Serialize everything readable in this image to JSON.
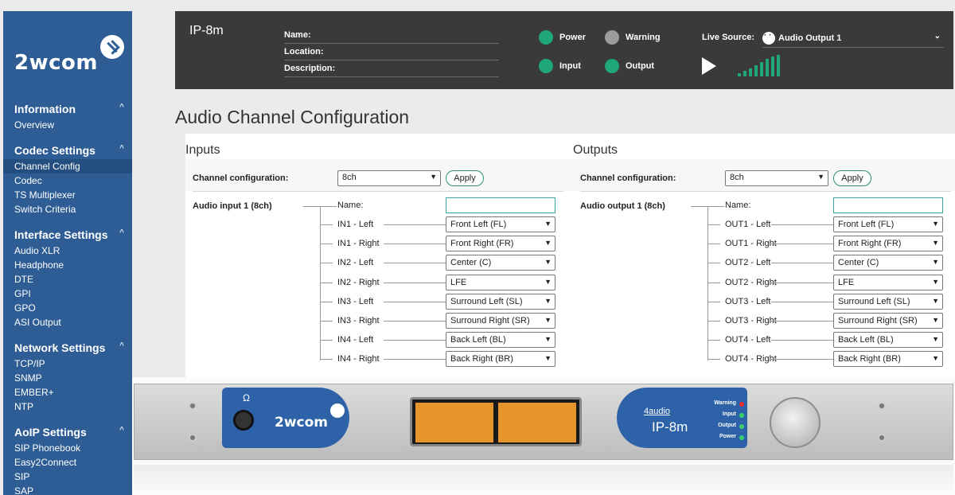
{
  "brand": {
    "logo_text": "2wcom"
  },
  "sidebar": {
    "sections": [
      {
        "title": "Information",
        "items": [
          "Overview"
        ]
      },
      {
        "title": "Codec Settings",
        "items": [
          "Channel Config",
          "Codec",
          "TS Multiplexer",
          "Switch Criteria"
        ]
      },
      {
        "title": "Interface Settings",
        "items": [
          "Audio XLR",
          "Headphone",
          "DTE",
          "GPI",
          "GPO",
          "ASI Output"
        ]
      },
      {
        "title": "Network Settings",
        "items": [
          "TCP/IP",
          "SNMP",
          "EMBER+",
          "NTP"
        ]
      },
      {
        "title": "AoIP Settings",
        "items": [
          "SIP Phonebook",
          "Easy2Connect",
          "SIP",
          "SAP"
        ]
      }
    ],
    "active_item": "Channel Config",
    "chevron": "chevron-up-icon"
  },
  "header": {
    "device": "IP-8m",
    "fields": {
      "name": "Name:",
      "location": "Location:",
      "description": "Description:"
    },
    "status": {
      "power": "Power",
      "warning": "Warning",
      "input": "Input",
      "output": "Output"
    },
    "status_colors": {
      "power": "#1fa67a",
      "warning": "#9c9c9c",
      "input": "#1fa67a",
      "output": "#1fa67a"
    },
    "live_source_label": "Live Source:",
    "live_source_value": "Audio Output 1"
  },
  "page_title": "Audio Channel Configuration",
  "inputs": {
    "title": "Inputs",
    "channel_config_label": "Channel configuration:",
    "channel_config_value": "8ch",
    "apply": "Apply",
    "group_label": "Audio input 1 (8ch)",
    "name_label": "Name:",
    "rows": [
      {
        "label": "IN1 - Left",
        "value": "Front Left (FL)"
      },
      {
        "label": "IN1 - Right",
        "value": "Front Right (FR)"
      },
      {
        "label": "IN2 - Left",
        "value": "Center (C)"
      },
      {
        "label": "IN2 - Right",
        "value": "LFE"
      },
      {
        "label": "IN3 - Left",
        "value": "Surround Left (SL)"
      },
      {
        "label": "IN3 - Right",
        "value": "Surround Right (SR)"
      },
      {
        "label": "IN4 - Left",
        "value": "Back Left (BL)"
      },
      {
        "label": "IN4 - Right",
        "value": "Back Right (BR)"
      }
    ]
  },
  "outputs": {
    "title": "Outputs",
    "channel_config_label": "Channel configuration:",
    "channel_config_value": "8ch",
    "apply": "Apply",
    "group_label": "Audio output 1 (8ch)",
    "name_label": "Name:",
    "rows": [
      {
        "label": "OUT1 - Left",
        "value": "Front Left (FL)"
      },
      {
        "label": "OUT1 - Right",
        "value": "Front Right (FR)"
      },
      {
        "label": "OUT2 - Left",
        "value": "Center (C)"
      },
      {
        "label": "OUT2 - Right",
        "value": "LFE"
      },
      {
        "label": "OUT3 - Left",
        "value": "Surround Left (SL)"
      },
      {
        "label": "OUT3 - Right",
        "value": "Surround Right (SR)"
      },
      {
        "label": "OUT4 - Left",
        "value": "Back Left (BL)"
      },
      {
        "label": "OUT4 - Right",
        "value": "Back Right (BR)"
      }
    ]
  },
  "device_image": {
    "logo": "2wcom",
    "brand": "4audio",
    "model": "IP-8m",
    "leds": [
      "Warning",
      "Input",
      "Output",
      "Power"
    ]
  },
  "colors": {
    "sidebar": "#2d5d94",
    "accent_green": "#1fa67a",
    "header_bg": "#3a3a3a"
  }
}
